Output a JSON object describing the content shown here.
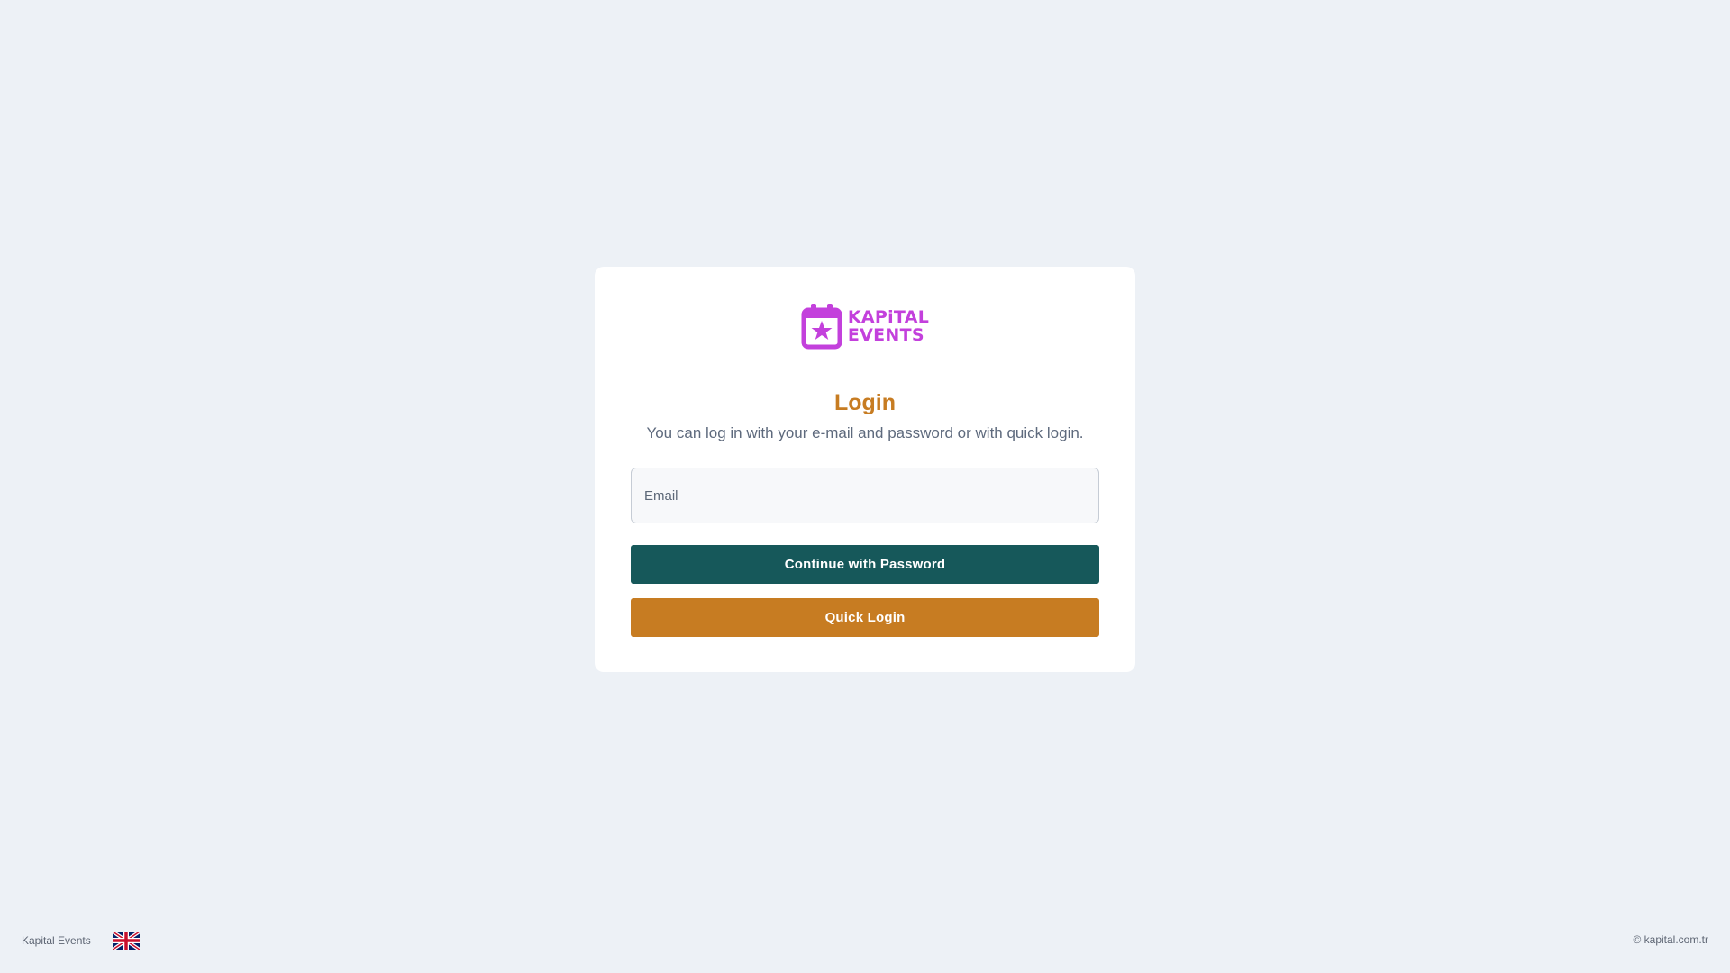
{
  "brand": {
    "logo_line1": "KAPiTAL",
    "logo_line2": "EVENTS",
    "logo_color": "#c340dc"
  },
  "login": {
    "title": "Login",
    "subtitle": "You can log in with your e-mail and password or with quick login.",
    "email_placeholder": "Email",
    "email_value": "",
    "continue_button": "Continue with Password",
    "quick_login_button": "Quick Login"
  },
  "footer": {
    "brand": "Kapital Events",
    "language_flag": "uk-flag-icon",
    "copyright": "© kapital.com.tr"
  },
  "colors": {
    "background": "#edf1f6",
    "title": "#c77c22",
    "primary_button": "#16585a",
    "quick_button": "#c77c22"
  }
}
